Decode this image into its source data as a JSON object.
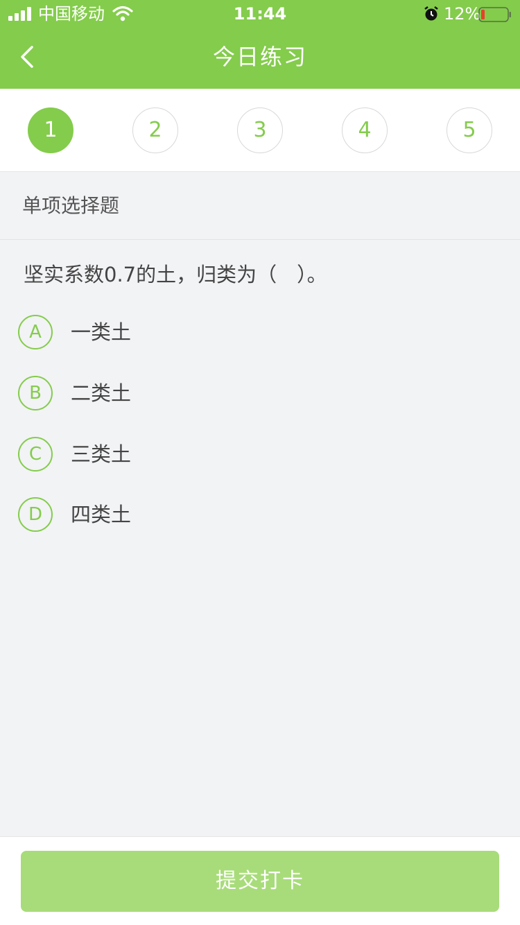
{
  "status_bar": {
    "carrier": "中国移动",
    "time": "11:44",
    "battery_percent": "12%",
    "icons": [
      "signal-icon",
      "wifi-icon",
      "alarm-icon",
      "battery-icon"
    ]
  },
  "nav": {
    "title": "今日练习",
    "back_icon": "chevron-left-icon"
  },
  "steps": {
    "items": [
      "1",
      "2",
      "3",
      "4",
      "5"
    ],
    "active_index": 0
  },
  "question": {
    "type_label": "单项选择题",
    "text": "坚实系数0.7的土，归类为（　）。",
    "options": [
      {
        "letter": "A",
        "text": "一类土"
      },
      {
        "letter": "B",
        "text": "二类土"
      },
      {
        "letter": "C",
        "text": "三类土"
      },
      {
        "letter": "D",
        "text": "四类土"
      }
    ]
  },
  "footer": {
    "submit_label": "提交打卡"
  },
  "colors": {
    "accent": "#84cc4c",
    "button": "#a8dc7a",
    "background": "#f2f3f5",
    "battery_low": "#e8412c"
  }
}
